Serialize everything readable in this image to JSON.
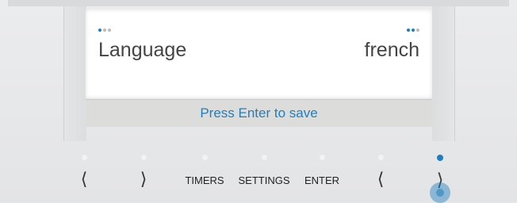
{
  "screen": {
    "setting_label": "Language",
    "setting_value": "french",
    "status_message": "Press Enter to save"
  },
  "buttons": [
    {
      "id": "prev-left",
      "label": "⟨",
      "led": false
    },
    {
      "id": "next-left",
      "label": "⟩",
      "led": false
    },
    {
      "id": "timers",
      "label": "TIMERS",
      "led": false
    },
    {
      "id": "settings",
      "label": "SETTINGS",
      "led": false
    },
    {
      "id": "enter",
      "label": "ENTER",
      "led": false
    },
    {
      "id": "prev-right",
      "label": "⟨",
      "led": false
    },
    {
      "id": "next-right",
      "label": "⟩",
      "led": true
    }
  ],
  "colors": {
    "accent": "#1f7fbe",
    "screen_bg": "#ffffff",
    "panel_bg": "#e5e6e8",
    "status_bg": "#dcdddb"
  },
  "icons": {
    "left_indicator": "three-dots-icon",
    "right_indicator": "three-dots-icon",
    "previous": "chevron-left-icon",
    "next": "chevron-right-icon"
  }
}
